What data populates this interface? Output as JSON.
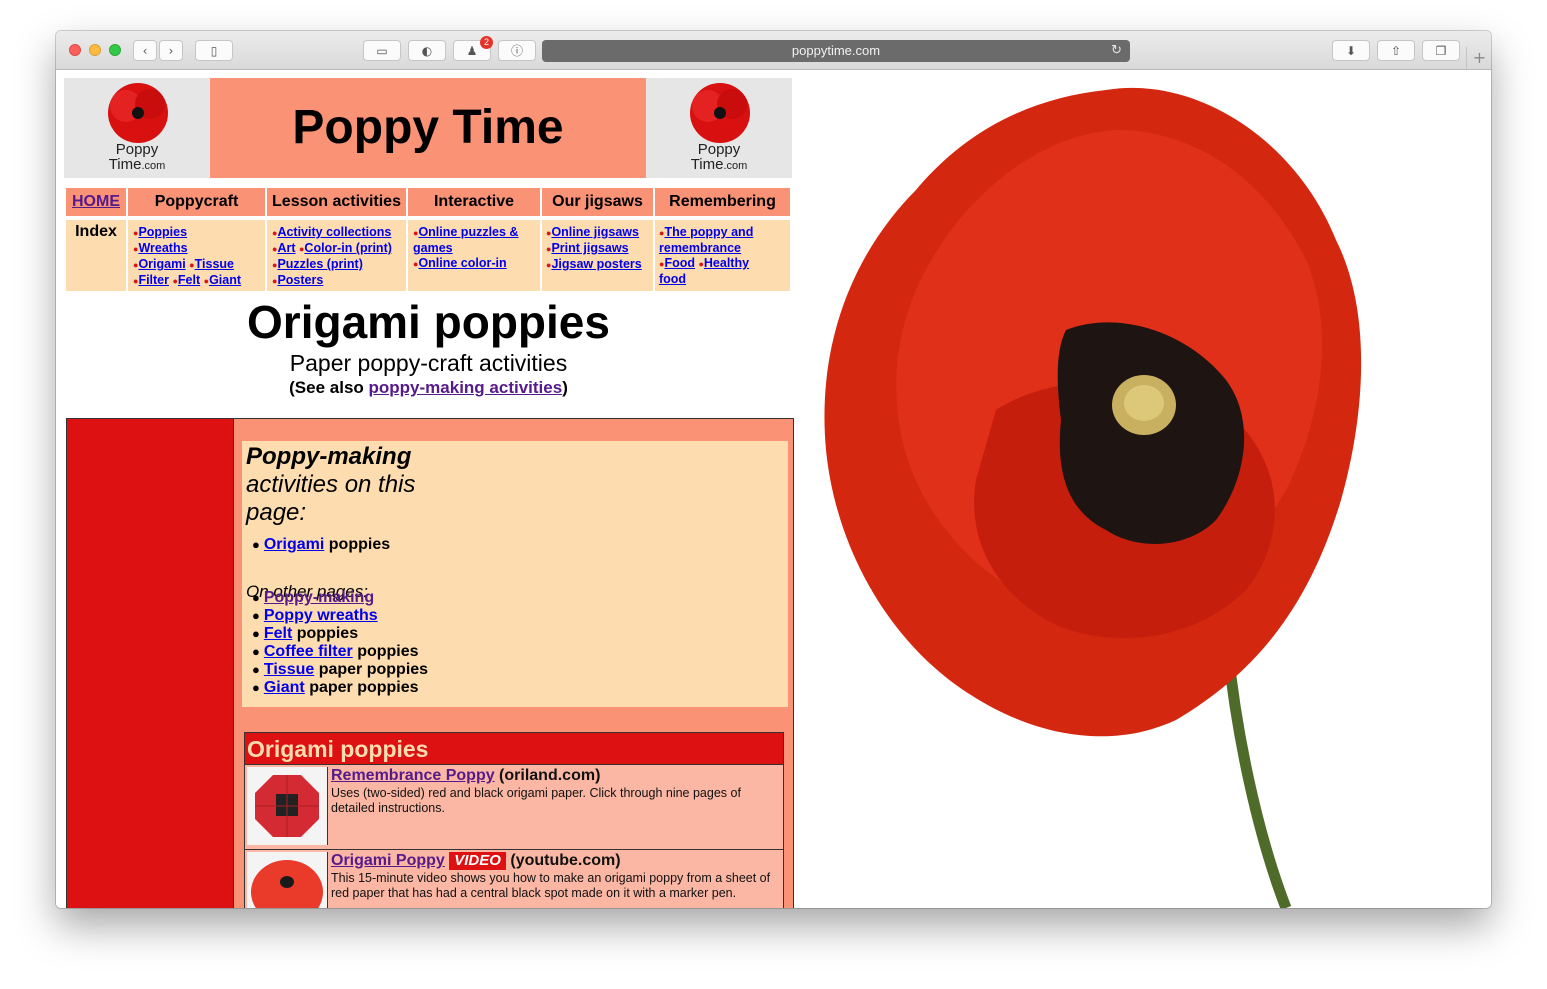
{
  "browser": {
    "url": "poppytime.com",
    "badge_count": "2"
  },
  "header": {
    "title": "Poppy Time",
    "logo_line1": "Poppy",
    "logo_line2": "Time",
    "logo_suffix": ".com"
  },
  "nav": {
    "home": "HOME",
    "poppycraft": "Poppycraft",
    "lesson": "Lesson activities",
    "interactive": "Interactive",
    "jigsaws": "Our jigsaws",
    "remembering": "Remembering",
    "index": "Index"
  },
  "sub": {
    "poppycraft": [
      "Poppies",
      "Wreaths",
      "Origami",
      "Tissue",
      "Filter",
      "Felt",
      "Giant"
    ],
    "lesson": [
      "Activity collections",
      "Art",
      "Color-in (print)",
      "Puzzles (print)",
      "Posters"
    ],
    "interactive": [
      "Online puzzles &",
      "games",
      "Online color-in"
    ],
    "jigsaws": [
      "Online jigsaws",
      "Print jigsaws",
      "Jigsaw posters"
    ],
    "remembering": [
      "The poppy and",
      "remembrance",
      "Food",
      "Healthy",
      "food"
    ]
  },
  "heading": {
    "title": "Origami poppies",
    "subtitle": "Paper poppy-craft activities",
    "see_prefix": "(See also ",
    "see_link": "poppy-making activities",
    "see_suffix": ")"
  },
  "toc": {
    "title_bold": "Poppy-making",
    "title_line2": "activities on this",
    "title_line3": "page:",
    "this_page": [
      {
        "link": "Origami",
        "rest": " poppies"
      }
    ],
    "other_label": "On other pages:",
    "other_pages": [
      {
        "link": "Poppy-making",
        "rest": ""
      },
      {
        "link": "Poppy wreaths",
        "rest": ""
      },
      {
        "link": "Felt",
        "rest": " poppies"
      },
      {
        "link": "Coffee filter",
        "rest": " poppies"
      },
      {
        "link": "Tissue",
        "rest": " paper poppies"
      },
      {
        "link": "Giant",
        "rest": " paper poppies"
      }
    ]
  },
  "origami": {
    "heading": "Origami poppies",
    "entries": [
      {
        "title": "Remembrance Poppy",
        "source": " (oriland.com)",
        "desc": "Uses (two-sided) red and black origami paper. Click through nine pages of detailed instructions.",
        "video": ""
      },
      {
        "title": "Origami Poppy",
        "source": " (youtube.com)",
        "desc": "This 15-minute video shows you how to make an origami poppy from a sheet of red paper that has had a central black spot made on it with a marker pen.",
        "video": "VIDEO"
      }
    ]
  },
  "colors": {
    "salmon": "#fa9276",
    "cream": "#fddcaf",
    "red": "#dd1111",
    "pink": "#fbb7a4"
  }
}
